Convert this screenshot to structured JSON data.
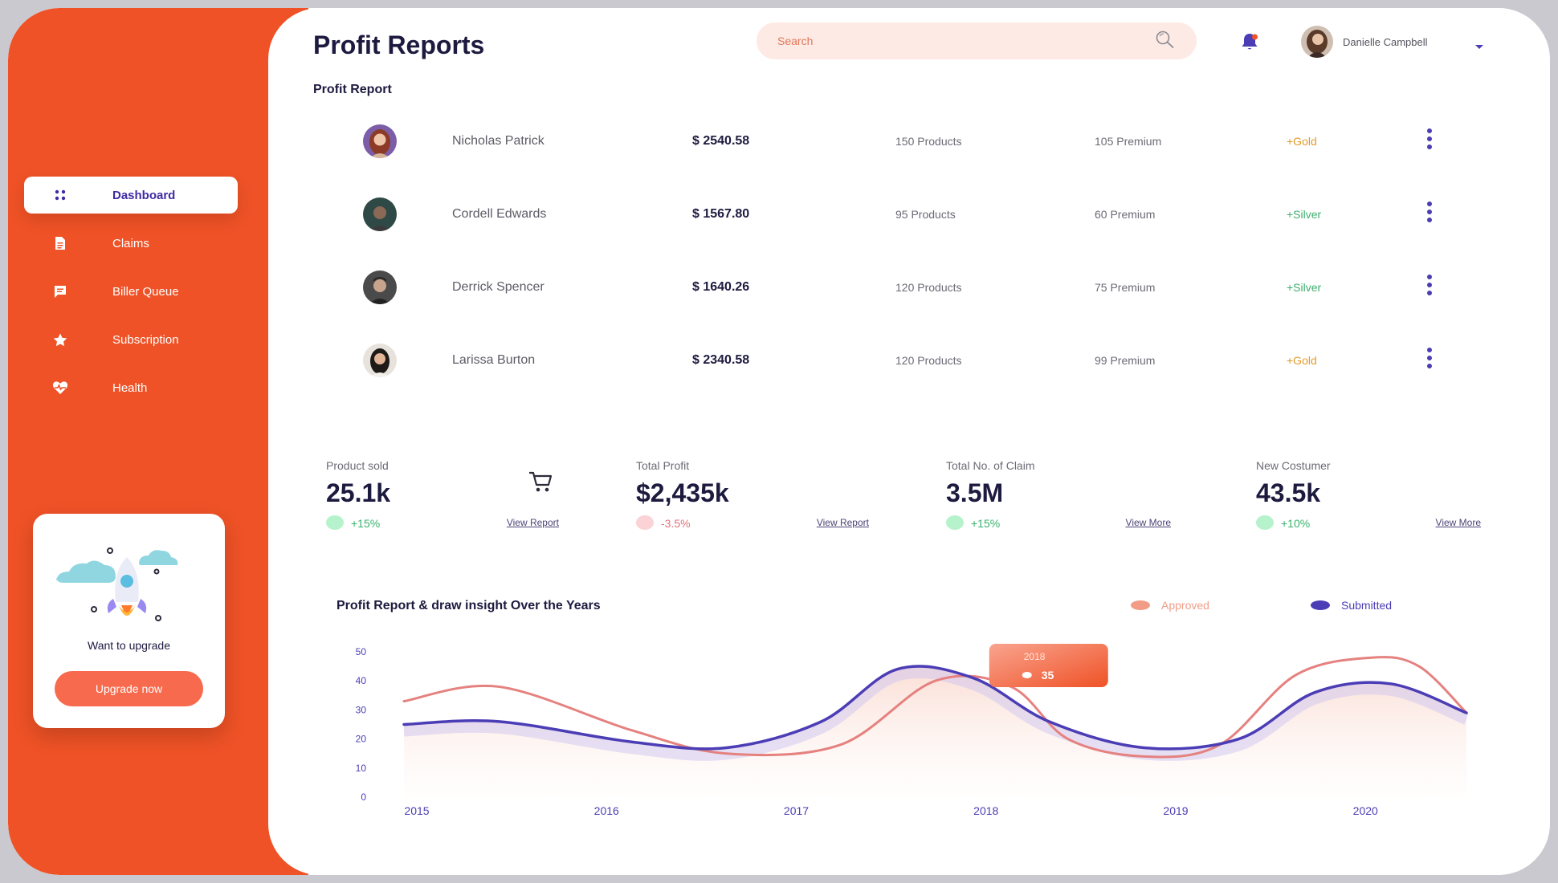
{
  "header": {
    "title": "Profit Reports",
    "section": "Profit Report",
    "search_placeholder": "Search",
    "user_name": "Danielle Campbell"
  },
  "sidebar": {
    "items": [
      {
        "label": "Dashboard",
        "icon": "grid-icon",
        "active": true
      },
      {
        "label": "Claims",
        "icon": "document-icon",
        "active": false
      },
      {
        "label": "Biller Queue",
        "icon": "message-icon",
        "active": false
      },
      {
        "label": "Subscription",
        "icon": "star-icon",
        "active": false
      },
      {
        "label": "Health",
        "icon": "heart-pulse-icon",
        "active": false
      }
    ],
    "upgrade": {
      "title": "Want to upgrade",
      "button": "Upgrade now"
    }
  },
  "report_rows": [
    {
      "name": "Nicholas Patrick",
      "amount": "$ 2540.58",
      "products": "150 Products",
      "premium": "105 Premium",
      "tier": "+Gold"
    },
    {
      "name": "Cordell Edwards",
      "amount": "$ 1567.80",
      "products": "95 Products",
      "premium": "60 Premium",
      "tier": "+Silver"
    },
    {
      "name": "Derrick Spencer",
      "amount": "$ 1640.26",
      "products": "120 Products",
      "premium": "75 Premium",
      "tier": "+Silver"
    },
    {
      "name": "Larissa Burton",
      "amount": "$ 2340.58",
      "products": "120 Products",
      "premium": "99 Premium",
      "tier": "+Gold"
    }
  ],
  "stats": [
    {
      "label": "Product sold",
      "value": "25.1k",
      "delta": "+15%",
      "trend": "up",
      "link": "View Report"
    },
    {
      "label": "Total Profit",
      "value": "$2,435k",
      "delta": "-3.5%",
      "trend": "down",
      "link": "View Report"
    },
    {
      "label": "Total No. of Claim",
      "value": "3.5M",
      "delta": "+15%",
      "trend": "up",
      "link": "View More"
    },
    {
      "label": "New Costumer",
      "value": "43.5k",
      "delta": "+10%",
      "trend": "up",
      "link": "View More"
    }
  ],
  "colors": {
    "brand": "#ef5226",
    "accent_purple": "#4b3db5",
    "approved": "#e5817f",
    "gold": "#e29a2a",
    "silver": "#3fae6f",
    "positive": "#36b26b",
    "negative": "#e0727a"
  },
  "chart_data": {
    "type": "line",
    "title": "Profit Report & draw insight Over the Years",
    "x": [
      2015,
      2016,
      2017,
      2018,
      2019,
      2020
    ],
    "xlim": [
      2015,
      2020.6
    ],
    "ylim": [
      0,
      50
    ],
    "yticks": [
      0,
      10,
      20,
      30,
      40,
      50
    ],
    "series": [
      {
        "name": "Approved",
        "color": "#e5817f",
        "points": [
          [
            2015,
            33
          ],
          [
            2015.5,
            38
          ],
          [
            2016.2,
            23
          ],
          [
            2016.7,
            15
          ],
          [
            2017.3,
            18
          ],
          [
            2017.8,
            40
          ],
          [
            2018.2,
            38
          ],
          [
            2018.5,
            20
          ],
          [
            2018.9,
            14
          ],
          [
            2019.3,
            18
          ],
          [
            2019.7,
            42
          ],
          [
            2020.1,
            48
          ],
          [
            2020.35,
            45
          ],
          [
            2020.6,
            29
          ]
        ]
      },
      {
        "name": "Submitted",
        "color": "#4b3db5",
        "points": [
          [
            2015,
            25
          ],
          [
            2015.5,
            26
          ],
          [
            2016.2,
            19
          ],
          [
            2016.7,
            17
          ],
          [
            2017.2,
            26
          ],
          [
            2017.6,
            44
          ],
          [
            2018,
            41
          ],
          [
            2018.4,
            26
          ],
          [
            2018.9,
            17
          ],
          [
            2019.4,
            20
          ],
          [
            2019.8,
            36
          ],
          [
            2020.2,
            39
          ],
          [
            2020.6,
            29
          ]
        ]
      }
    ],
    "tooltip": {
      "label": "2018",
      "value": "35"
    }
  }
}
